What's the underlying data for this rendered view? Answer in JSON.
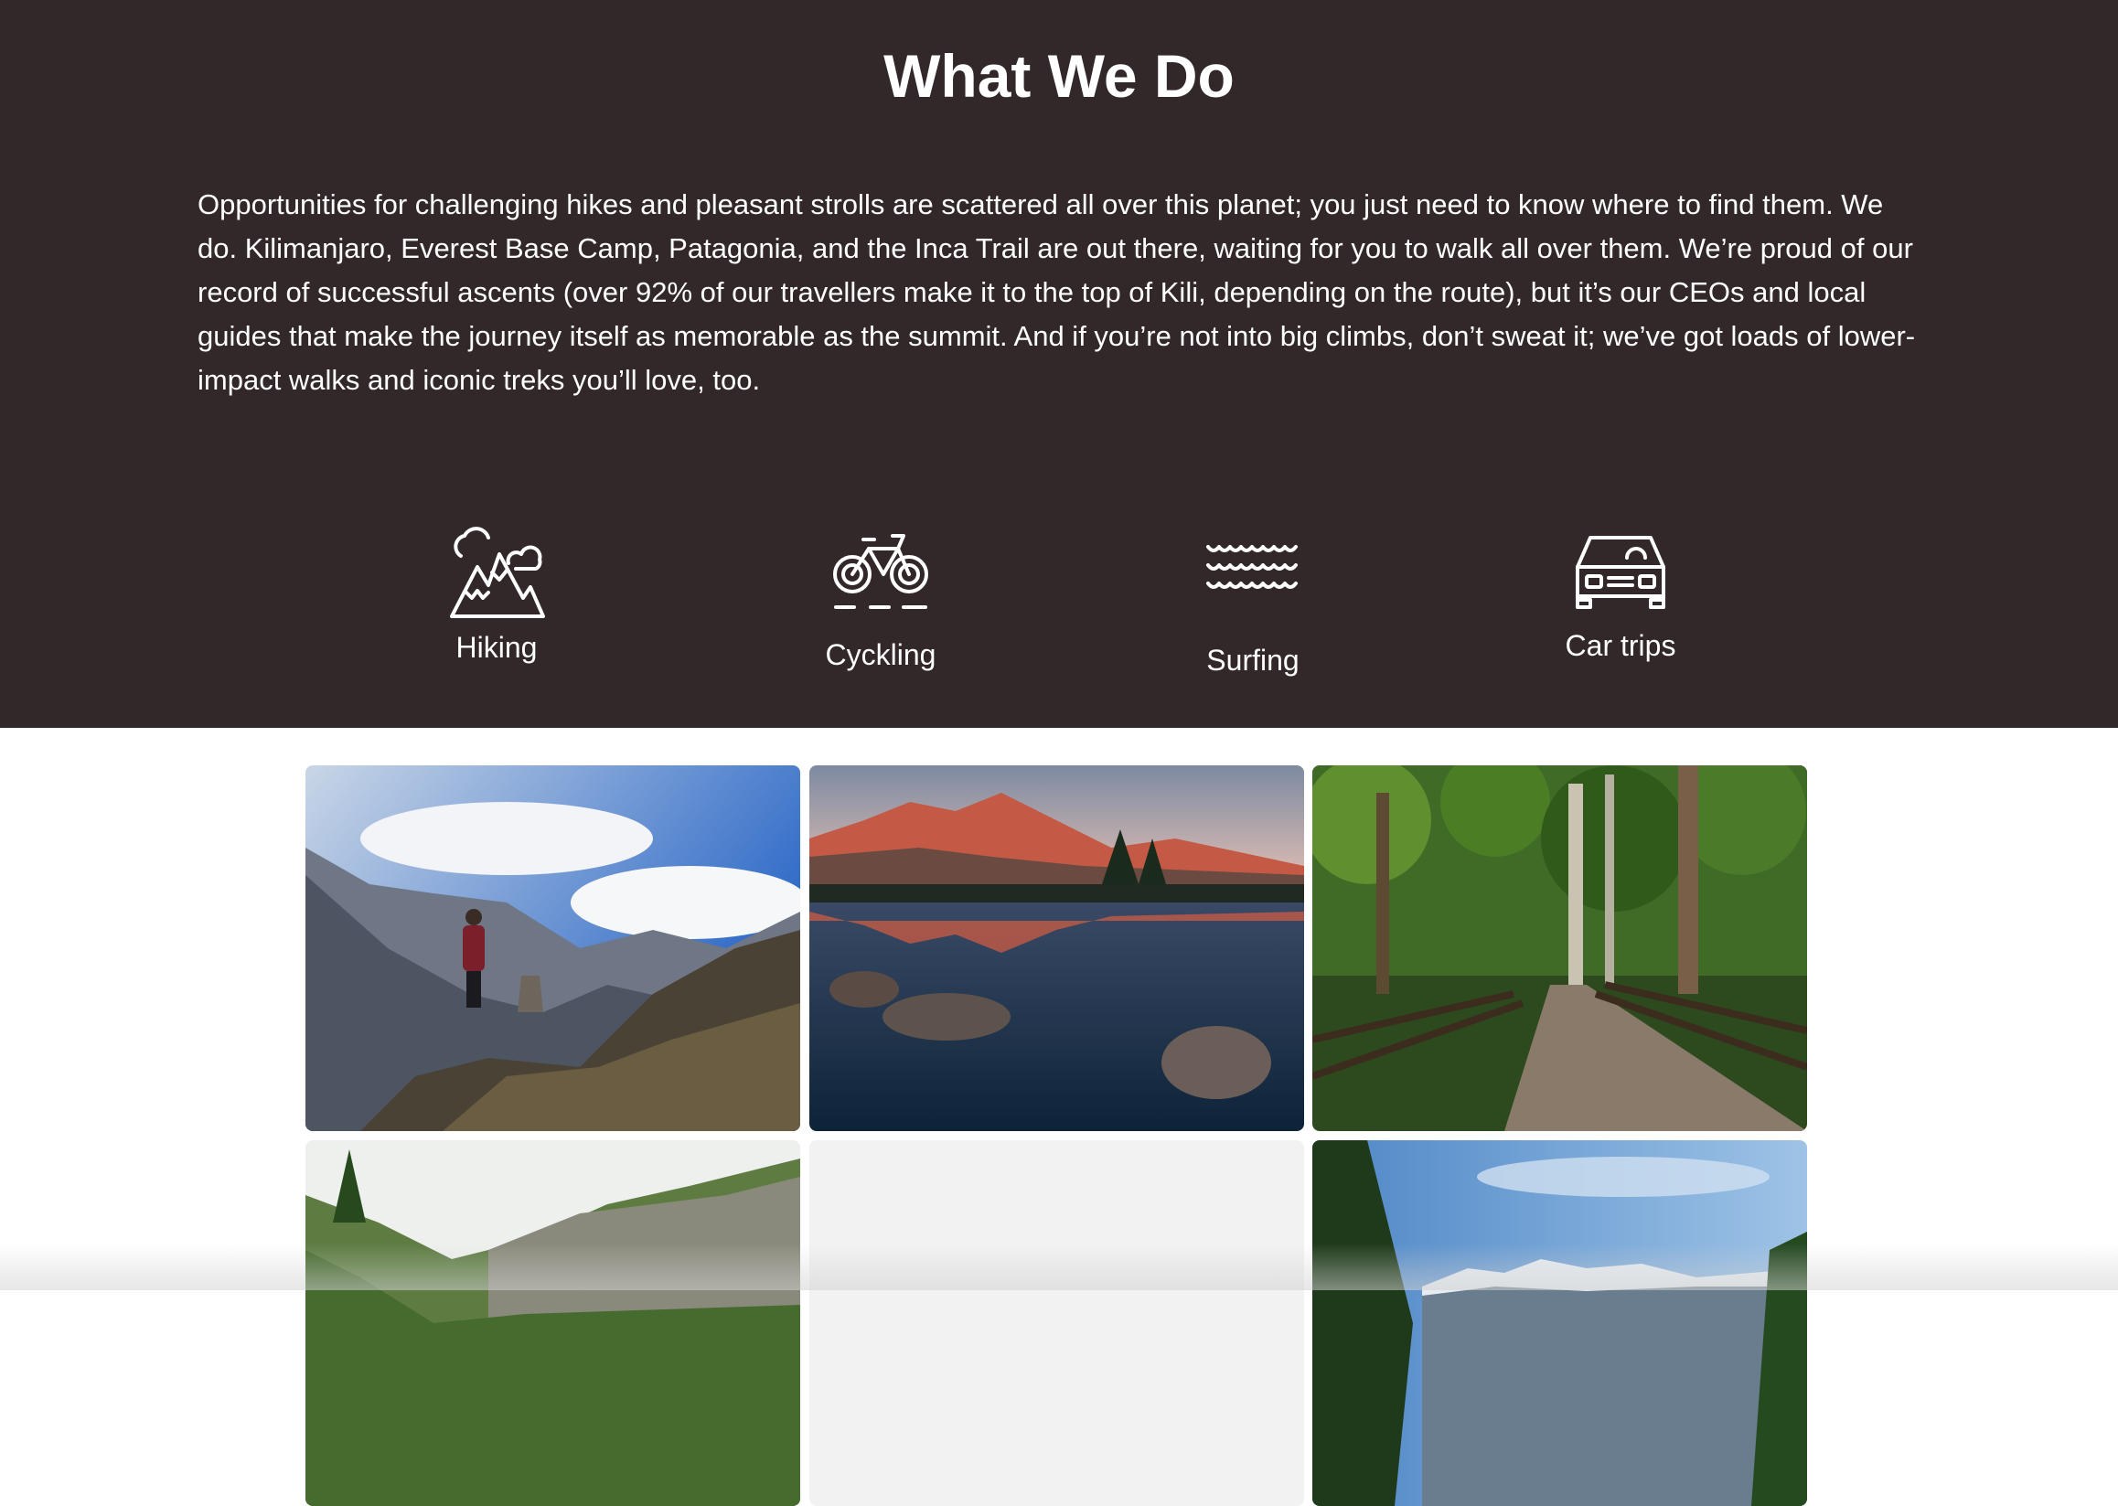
{
  "section": {
    "title": "What We Do",
    "description": "Opportunities for challenging hikes and pleasant strolls are scattered all over this planet; you just need to know where to find them. We do. Kilimanjaro, Everest Base Camp, Patagonia, and the Inca Trail are out there, waiting for you to walk all over them. We’re proud of our record of successful ascents (over 92% of our travellers make it to the top of Kili, depending on the route), but it’s our CEOs and local guides that make the journey itself as memorable as the summit. And if you’re not into big climbs, don’t sweat it; we’ve got loads of lower-impact walks and iconic treks you’ll love, too."
  },
  "activities": [
    {
      "label": "Hiking",
      "icon": "mountain-hiking-icon"
    },
    {
      "label": "Cyckling",
      "icon": "bicycle-icon"
    },
    {
      "label": "Surfing",
      "icon": "waves-icon"
    },
    {
      "label": "Car trips",
      "icon": "car-icon"
    }
  ],
  "colors": {
    "hero_background": "#322829",
    "text": "#ffffff",
    "page_background": "#ffffff"
  },
  "gallery": {
    "photos": [
      {
        "subject": "hiker-on-mountain-ridge"
      },
      {
        "subject": "red-mountain-lake-reflection"
      },
      {
        "subject": "forest-path-with-fence"
      },
      {
        "subject": "green-mountain-valley"
      },
      {
        "subject": "image-placeholder"
      },
      {
        "subject": "snowy-mountains-blue-sky"
      }
    ]
  }
}
